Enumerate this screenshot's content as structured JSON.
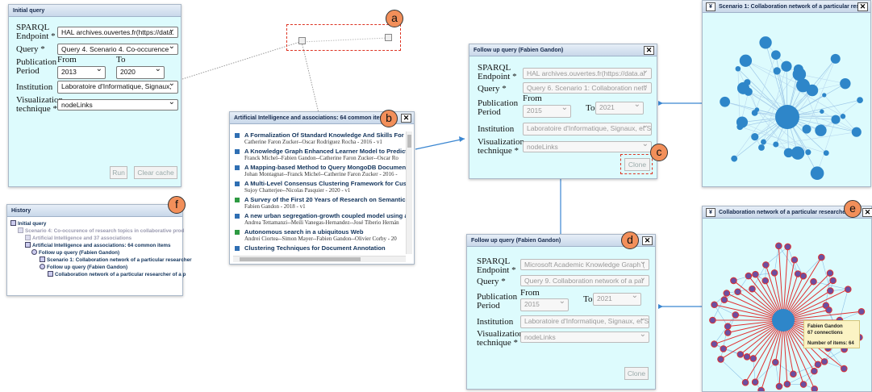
{
  "badges": {
    "a": "a",
    "b": "b",
    "c": "c",
    "d": "d",
    "e": "e",
    "f": "f"
  },
  "initial": {
    "title": "Initial query",
    "endpoint_label": "SPARQL Endpoint *",
    "endpoint_value": "HAL archives.ouvertes.fr(https://data.",
    "query_label": "Query *",
    "query_value": "Query 4. Scenario 4. Co-occurence",
    "from_label": "From",
    "to_label": "To",
    "period_label": "Publication Period",
    "from_value": "2013",
    "to_value": "2020",
    "institution_label": "Institution",
    "institution_value": "Laboratoire d'Informatique, Signaux, ",
    "vis_label": "Visualization technique *",
    "vis_value": "nodeLinks",
    "run": "Run",
    "clear": "Clear cache"
  },
  "results": {
    "title": "Artificial Intelligence and associations: 64 common items",
    "items": [
      {
        "title": "A Formalization Of Standard Knowledge And Skills For T",
        "sub": "Catherine Faron Zucker--Oscar Rodriguez Rocha - 2016 - v1",
        "color": "blue"
      },
      {
        "title": "A Knowledge Graph Enhanced Learner Model to Predict C",
        "sub": "Franck Michel--Fabien Gandon--Catherine Faron Zucker--Oscar Ro",
        "color": "blue"
      },
      {
        "title": "A Mapping-based Method to Query MongoDB Documents",
        "sub": "Johan Montagnat--Franck Michel--Catherine Faron Zucker - 2016 -",
        "color": "blue"
      },
      {
        "title": "A Multi-Level Consensus Clustering Framework for Custo",
        "sub": "Sujoy Chatterjee--Nicolas Pasquier - 2020 - v1",
        "color": "blue"
      },
      {
        "title": "A Survey of the First 20 Years of Research on Semantic W",
        "sub": "Fabien Gandon - 2018 - v1",
        "color": "green"
      },
      {
        "title": "A new urban segregation-growth coupled model using a",
        "sub": "Andrea Tettamanzi--Meili Vanegas-Hernandez--José Tiberio Hernán",
        "color": "blue"
      },
      {
        "title": "Autonomous search in a ubiquitous Web",
        "sub": "Andrei Ciortea--Simon Mayer--Fabien Gandon--Olivier Corby - 20",
        "color": "green"
      },
      {
        "title": "Clustering Techniques for Document Annotation",
        "sub": "",
        "color": "blue"
      }
    ]
  },
  "followup1": {
    "title": "Follow up query (Fabien Gandon)",
    "endpoint_label": "SPARQL Endpoint *",
    "endpoint_value": "HAL archives.ouvertes.fr(https://data.ar",
    "query_label": "Query *",
    "query_value": "Query 6. Scenario 1: Collaboration netv",
    "from_label": "From",
    "to_label": "To",
    "period_label": "Publication Period",
    "from_value": "2015",
    "to_value": "2021",
    "institution_label": "Institution",
    "institution_value": "Laboratoire d'Informatique, Signaux, et S",
    "vis_label": "Visualization technique *",
    "vis_value": "nodeLinks",
    "clone": "Clone"
  },
  "followup2": {
    "title": "Follow up query (Fabien Gandon)",
    "endpoint_label": "SPARQL Endpoint *",
    "endpoint_value": "Microsoft Academic Knowledge Graph (",
    "query_label": "Query *",
    "query_value": "Query 9. Collaboration network of a par",
    "from_label": "From",
    "to_label": "To",
    "period_label": "Publication Period",
    "from_value": "2015",
    "to_value": "2021",
    "institution_label": "Institution",
    "institution_value": "Laboratoire d'Informatique, Signaux, et S",
    "vis_label": "Visualization technique *",
    "vis_value": "nodeLinks",
    "clone": "Clone"
  },
  "graph1": {
    "title": "Scenario 1: Collaboration network of a particular res..."
  },
  "graph2": {
    "title": "Collaboration network of a particular researcher",
    "tooltip_name": "Fabien Gandon",
    "tooltip_connections": "67 connections",
    "tooltip_items": "Number of items: 64"
  },
  "history": {
    "title": "History",
    "items": [
      {
        "label": "Initial query"
      },
      {
        "label": "Scenario 4: Co-occurence of research topics in collaborative prod"
      },
      {
        "label": "Artificial Intelligence and 37 associations"
      },
      {
        "label": "Artificial Intelligence and associations: 64 common items"
      },
      {
        "label": "Follow up query (Fabien Gandon)"
      },
      {
        "label": "Scenario 1: Collaboration network of a particular researcher"
      },
      {
        "label": "Follow up query (Fabien Gandon)"
      },
      {
        "label": "Collaboration network of a particular researcher of a p"
      }
    ]
  },
  "colors": {
    "window_bg": "#ddfbfd",
    "badge": "#f28f5a",
    "node_blue": "#2e86c9",
    "red_link": "#e03030",
    "purple_node": "#6b4fa0"
  }
}
